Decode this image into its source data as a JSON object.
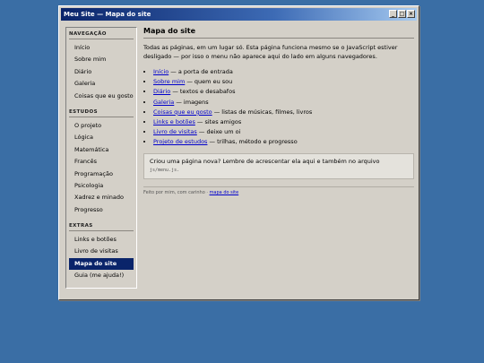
{
  "window": {
    "title": "Meu Site — Mapa do site",
    "minimize": "_",
    "maximize": "□",
    "close": "×"
  },
  "sidebar": {
    "sections": [
      {
        "heading": "NAVEGAÇÃO",
        "items": [
          "Início",
          "Sobre mim",
          "Diário",
          "Galeria",
          "Coisas que eu gosto"
        ]
      },
      {
        "heading": "ESTUDOS",
        "items": [
          "O projeto",
          "Lógica",
          "Matemática",
          "Francês",
          "Programação",
          "Psicologia",
          "Xadrez e minado",
          "Progresso"
        ]
      },
      {
        "heading": "EXTRAS",
        "items": [
          "Links e botões",
          "Livro de visitas",
          "Mapa do site",
          "Guia (me ajuda!)"
        ]
      }
    ],
    "active": "Mapa do site"
  },
  "main": {
    "title": "Mapa do site",
    "intro": "Todas as páginas, em um lugar só. Esta página funciona mesmo se o JavaScript estiver desligado — por isso o menu não aparece aqui do lado em alguns navegadores.",
    "links": [
      {
        "link": "Início",
        "desc": " — a porta de entrada"
      },
      {
        "link": "Sobre mim",
        "desc": " — quem eu sou"
      },
      {
        "link": "Diário",
        "desc": " — textos e desabafos"
      },
      {
        "link": "Galeria",
        "desc": " — imagens"
      },
      {
        "link": "Coisas que eu gosto",
        "desc": " — listas de músicas, filmes, livros"
      },
      {
        "link": "Links e botões",
        "desc": " — sites amigos"
      },
      {
        "link": "Livro de visitas",
        "desc": " — deixe um oi"
      },
      {
        "link": "Projeto de estudos",
        "desc": " — trilhas, método e progresso"
      }
    ],
    "note": "Criou uma página nova? Lembre de acrescentar ela aqui e também no arquivo",
    "note_code": "js/menu.js",
    "note_end": ".",
    "footer_text": "Feito por mim, com carinho · ",
    "footer_link": "mapa do site"
  }
}
